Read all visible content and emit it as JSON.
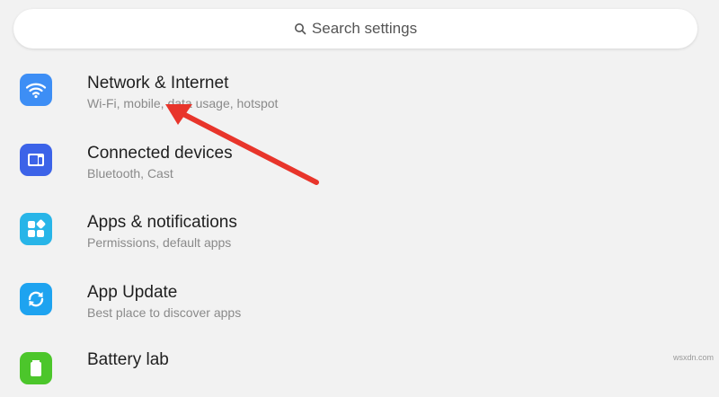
{
  "search": {
    "label": "Search settings",
    "icon": "search-icon"
  },
  "settings": [
    {
      "title": "Network & Internet",
      "subtitle": "Wi-Fi, mobile, data usage, hotspot",
      "icon": "wifi-icon",
      "color": "#3d8ef5"
    },
    {
      "title": "Connected devices",
      "subtitle": "Bluetooth, Cast",
      "icon": "devices-icon",
      "color": "#3c63e8"
    },
    {
      "title": "Apps & notifications",
      "subtitle": "Permissions, default apps",
      "icon": "apps-icon",
      "color": "#28b5e8"
    },
    {
      "title": "App Update",
      "subtitle": "Best place to discover apps",
      "icon": "update-icon",
      "color": "#1ea3f0"
    },
    {
      "title": "Battery lab",
      "subtitle": "",
      "icon": "battery-icon",
      "color": "#4cc62b"
    }
  ],
  "annotation": {
    "color": "#e8352b"
  },
  "watermark": "wsxdn.com"
}
